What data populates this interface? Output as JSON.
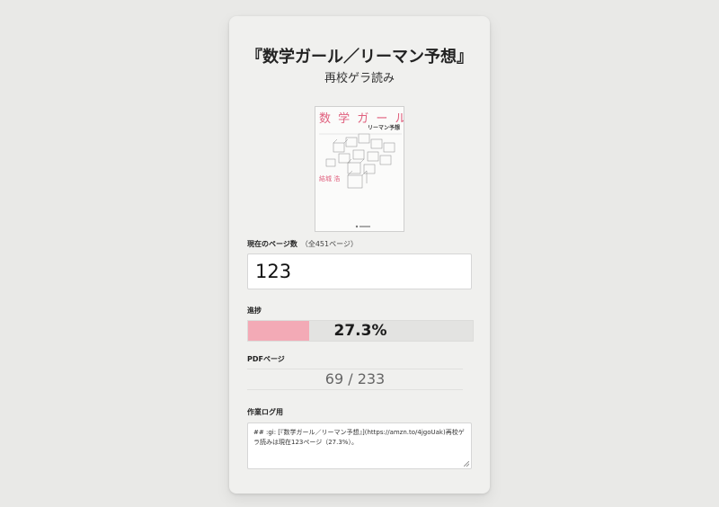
{
  "header": {
    "title": "『数学ガール／リーマン予想』",
    "subtitle": "再校ゲラ読み"
  },
  "cover": {
    "title": "数 学 ガ ー ル",
    "subtitle": "リーマン予想",
    "author": "結城 浩"
  },
  "page_field": {
    "label": "現在のページ数",
    "note": "（全451ページ）",
    "value": "123"
  },
  "progress": {
    "label": "進捗",
    "value_text": "27.3%",
    "fraction": 0.273,
    "fill_color": "#f3aab6"
  },
  "pdf": {
    "label": "PDFページ",
    "value": "69 / 233"
  },
  "log": {
    "label": "作業ログ用",
    "text": "## :gi: [『数学ガール／リーマン予想』](https://amzn.to/4jgoUak)再校ゲラ読みは現在123ページ（27.3%）。"
  }
}
